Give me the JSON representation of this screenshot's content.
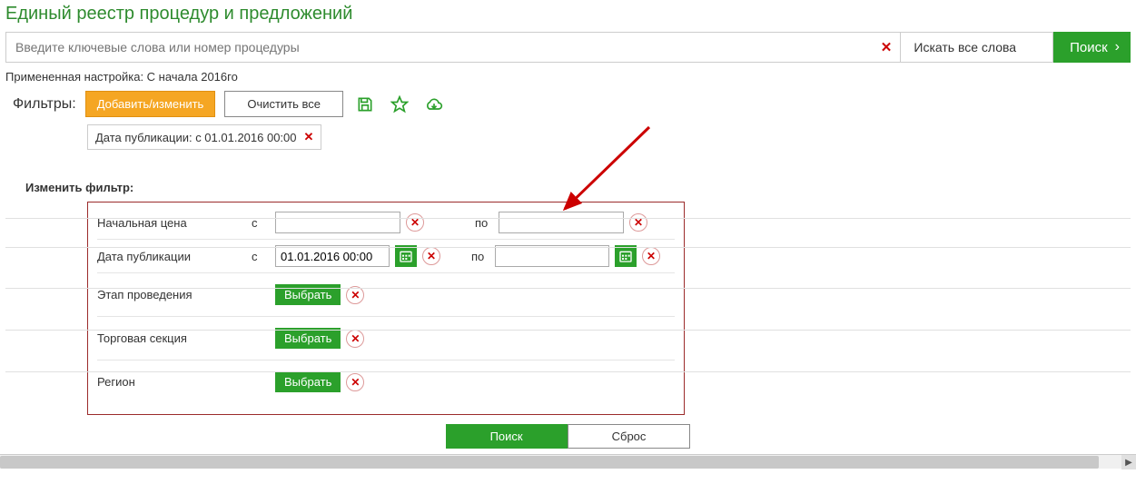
{
  "page_title": "Единый реестр процедур и предложений",
  "search": {
    "placeholder": "Введите ключевые слова или номер процедуры",
    "mode_label": "Искать все слова",
    "button_label": "Поиск"
  },
  "applied_setting": "Примененная настройка: С начала 2016го",
  "filters": {
    "label": "Фильтры:",
    "add_edit_label": "Добавить/изменить",
    "clear_all_label": "Очистить все"
  },
  "chip": {
    "text": "Дата публикации: с 01.01.2016 00:00"
  },
  "edit_filter_label": "Изменить фильтр:",
  "filter_rows": {
    "price_label": "Начальная цена",
    "date_label": "Дата публикации",
    "stage_label": "Этап проведения",
    "section_label": "Торговая секция",
    "region_label": "Регион",
    "from": "с",
    "to": "по",
    "date_from_value": "01.01.2016 00:00",
    "select_label": "Выбрать"
  },
  "bottom": {
    "search_label": "Поиск",
    "reset_label": "Сброс"
  }
}
